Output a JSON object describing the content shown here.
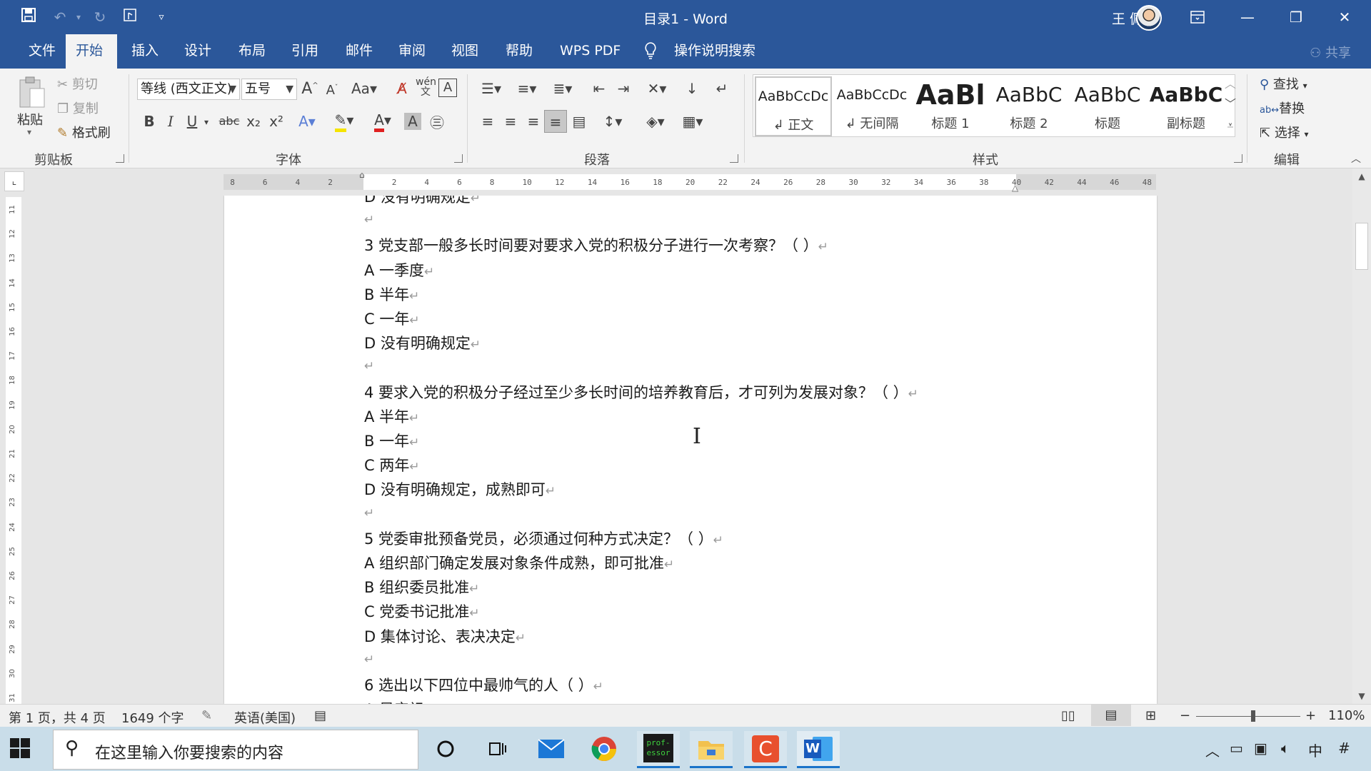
{
  "titlebar": {
    "title": "目录1  -  Word",
    "user": "王 佩丰",
    "icons": [
      "save-icon",
      "undo-icon",
      "redo-icon",
      "touch-mode-icon",
      "customize-qat-icon",
      "ribbon-display-icon",
      "minimize-icon",
      "restore-icon",
      "close-icon"
    ]
  },
  "menu": {
    "tabs": [
      "文件",
      "开始",
      "插入",
      "设计",
      "布局",
      "引用",
      "邮件",
      "审阅",
      "视图",
      "帮助",
      "WPS PDF"
    ],
    "active": "开始",
    "tell_me": "操作说明搜索",
    "share": "共享"
  },
  "ribbon": {
    "clipboard": {
      "paste": "粘贴",
      "cut": "剪切",
      "copy": "复制",
      "format_painter": "格式刷",
      "label": "剪贴板"
    },
    "font": {
      "name": "等线 (西文正文)",
      "size": "五号",
      "label": "字体",
      "bold": "B",
      "italic": "I",
      "underline": "U",
      "strike": "abc",
      "subscript": "x₂",
      "superscript": "x²"
    },
    "paragraph": {
      "label": "段落"
    },
    "styles": {
      "label": "样式",
      "items": [
        {
          "sample": "AaBbCcDc",
          "name": "↲ 正文"
        },
        {
          "sample": "AaBbCcDc",
          "name": "↲ 无间隔"
        },
        {
          "sample": "AaBl",
          "name": "标题 1"
        },
        {
          "sample": "AaBbC",
          "name": "标题 2"
        },
        {
          "sample": "AaBbC",
          "name": "标题"
        },
        {
          "sample": "AaBbC",
          "name": "副标题"
        }
      ]
    },
    "editing": {
      "find": "查找",
      "replace": "替换",
      "select": "选择",
      "label": "编辑"
    }
  },
  "ruler": {
    "left_ticks": [
      "8",
      "6",
      "4",
      "2"
    ],
    "right_ticks": [
      "2",
      "4",
      "6",
      "8",
      "10",
      "12",
      "14",
      "16",
      "18",
      "20",
      "22",
      "24",
      "26",
      "28",
      "30",
      "32",
      "34",
      "36",
      "38",
      "40",
      "42",
      "44",
      "46",
      "48"
    ],
    "vertical_ticks": [
      "11",
      "12",
      "13",
      "14",
      "15",
      "16",
      "17",
      "18",
      "19",
      "20",
      "21",
      "22",
      "23",
      "24",
      "25",
      "26",
      "27",
      "28",
      "29",
      "30",
      "31"
    ]
  },
  "document": {
    "lines": [
      {
        "text": "D  没有明确规定",
        "mark": "↵"
      },
      {
        "text": "",
        "mark": "↵"
      },
      {
        "text": "3  党支部一般多长时间要对要求入党的积极分子进行一次考察？（      ）",
        "mark": "↵"
      },
      {
        "text": "A  一季度",
        "mark": "↵"
      },
      {
        "text": "B  半年",
        "mark": "↵"
      },
      {
        "text": "C  一年",
        "mark": "↵"
      },
      {
        "text": "D  没有明确规定",
        "mark": "↵"
      },
      {
        "text": "",
        "mark": "↵"
      },
      {
        "text": "4  要求入党的积极分子经过至少多长时间的培养教育后，才可列为发展对象？（      ）",
        "mark": "↵"
      },
      {
        "text": "A  半年",
        "mark": "↵"
      },
      {
        "text": "B  一年",
        "mark": "↵"
      },
      {
        "text": "C  两年",
        "mark": "↵"
      },
      {
        "text": "D  没有明确规定，成熟即可",
        "mark": "↵"
      },
      {
        "text": "",
        "mark": "↵"
      },
      {
        "text": "5  党委审批预备党员，必须通过何种方式决定？（      ）",
        "mark": "↵"
      },
      {
        "text": "A  组织部门确定发展对象条件成熟，即可批准",
        "mark": "↵"
      },
      {
        "text": "B  组织委员批准",
        "mark": "↵"
      },
      {
        "text": "C  党委书记批准",
        "mark": "↵"
      },
      {
        "text": "D  集体讨论、表决决定",
        "mark": "↵"
      },
      {
        "text": "",
        "mark": "↵"
      },
      {
        "text": "6  选出以下四位中最帅气的人（      ）",
        "mark": "↵"
      },
      {
        "text": "A  吴彦祖",
        "mark": "↵"
      }
    ]
  },
  "statusbar": {
    "page": "第 1 页，共 4 页",
    "words": "1649 个字",
    "language": "英语(美国)",
    "zoom": "110%",
    "zoom_level": 0.55
  },
  "taskbar": {
    "search_placeholder": "在这里输入你要搜索的内容",
    "apps": [
      "cortana-icon",
      "task-view-icon",
      "mail-icon",
      "chrome-icon",
      "professor-icon",
      "file-explorer-icon",
      "canva-icon",
      "word-icon"
    ],
    "professor_label": "prof-essor",
    "ime": "中"
  },
  "colors": {
    "word_blue": "#2b579a",
    "taskbar": "#c9dde9"
  }
}
